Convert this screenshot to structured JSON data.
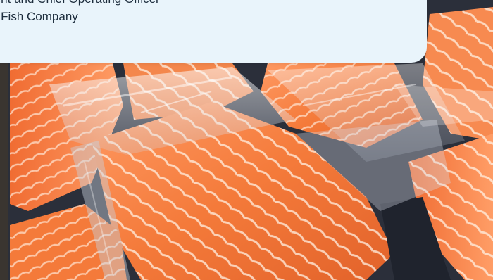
{
  "attribution": {
    "title_line": "sident and Chief Operating Officer",
    "company_line": "kes Fish Company"
  },
  "image": {
    "subject": "vacuum-packed salmon fillets"
  },
  "colors": {
    "card_background": "#e9f4fb",
    "text": "#1d2d3d",
    "salmon_light": "#ffa676",
    "salmon_dark": "#e85a28",
    "plastic_gray": "#8a96a8",
    "background_dark": "#1d2230"
  }
}
